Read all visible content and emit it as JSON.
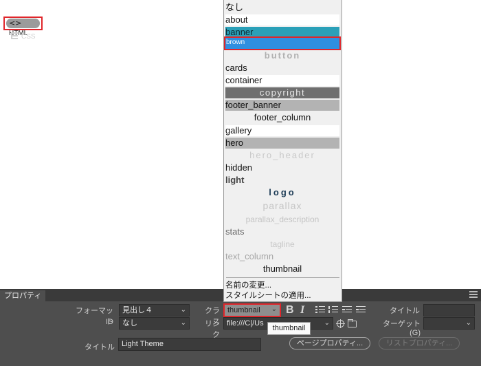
{
  "dropdown": {
    "items": [
      {
        "label": "なし"
      },
      {
        "label": "about"
      },
      {
        "label": "banner"
      },
      {
        "label": "brown"
      },
      {
        "label": "button"
      },
      {
        "label": "cards"
      },
      {
        "label": "container"
      },
      {
        "label": "copyright"
      },
      {
        "label": "footer_banner"
      },
      {
        "label": "footer_column"
      },
      {
        "label": "gallery"
      },
      {
        "label": "hero"
      },
      {
        "label": "hero_header"
      },
      {
        "label": "hidden"
      },
      {
        "label": "light"
      },
      {
        "label": "logo"
      },
      {
        "label": "parallax"
      },
      {
        "label": "parallax_description"
      },
      {
        "label": "stats"
      },
      {
        "label": "tagline"
      },
      {
        "label": "text_column"
      },
      {
        "label": "thumbnail"
      }
    ],
    "actions": {
      "rename": "名前の変更...",
      "apply_style": "スタイルシートの適用..."
    },
    "selected": "brown"
  },
  "panel": {
    "tab_label": "プロパティ",
    "html_toggle": "HTML",
    "css_toggle": "CSS",
    "format_label": "フォーマット",
    "format_value": "見出し４",
    "id_label": "ID",
    "id_value": "なし",
    "class_label": "クラス",
    "class_value": "thumbnail",
    "link_label": "リンク",
    "link_value": "file:///C|/Us",
    "tooltip": "thumbnail",
    "bold_label": "B",
    "italic_label": "I",
    "title_label_right": "タイトル",
    "target_label": "ターゲット (G)",
    "doc_title_label": "タイトル",
    "doc_title_value": "Light Theme",
    "page_props_button": "ページプロパティ...",
    "list_props_button": "リストプロパティ..."
  },
  "colors": {
    "selection": "#2f8fe0",
    "highlight_border": "#e0262b",
    "panel_bg": "#4e4e4e"
  },
  "icons": [
    "code-brackets-icon",
    "css-grid-icon",
    "unordered-list-icon",
    "ordered-list-icon",
    "outdent-icon",
    "indent-icon",
    "target-point-icon",
    "folder-icon",
    "panel-menu-icon"
  ]
}
